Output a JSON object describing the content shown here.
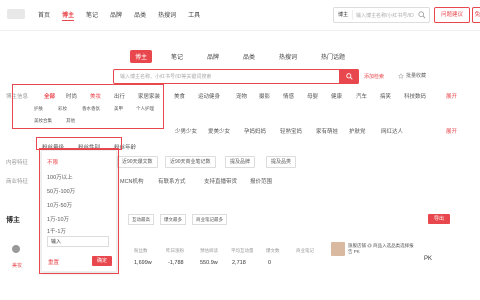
{
  "topnav": {
    "items": [
      "首页",
      "博主",
      "笔记",
      "品牌",
      "品类",
      "热搜词",
      "工具"
    ],
    "active_index": 1,
    "search_select": "博主",
    "search_placeholder": "输入博主名称/小红书号/ID",
    "feedback_label": "问题建议",
    "trial_label": "免费试用"
  },
  "subtabs": {
    "items": [
      "博主",
      "笔记",
      "品牌",
      "品类",
      "热搜词",
      "热门话题"
    ],
    "active_index": 0
  },
  "search": {
    "placeholder": "输入博主名称、小红书号/ID等关键词搜索",
    "advanced_label": "添加检索",
    "favorite_label": "批量收藏"
  },
  "filters": {
    "category_label": "博主信息",
    "categories_row1": [
      "全部",
      "时尚",
      "美妆",
      "出行",
      "家居家装",
      "美食",
      "运动健身",
      "宠物",
      "摄影",
      "情感",
      "母婴",
      "健康",
      "汽车",
      "搞笑",
      "科技数码"
    ],
    "expand_label": "展开",
    "categories_row2": [
      "护肤",
      "彩妆",
      "香水香氛",
      "美甲",
      "个人护理"
    ],
    "categories_row3": [
      "美妆合集",
      "其他"
    ],
    "tags_label": "",
    "tags": [
      "少男少女",
      "爱美少女",
      "孕妈妈妈",
      "轻熟宝妈",
      "家有萌娃",
      "护肤党",
      "网红达人"
    ],
    "tags_expand": "展开",
    "dropdowns": [
      "粉丝量级",
      "粉丝性别",
      "粉丝年龄"
    ],
    "content_label": "内容特征",
    "content_chips": [
      "近90天爆文数",
      "近90天商业笔记数",
      "提及品牌",
      "提及品类"
    ],
    "platform_label": "商业特征",
    "platform_chips": [
      "MCN机构",
      "有联系方式",
      "支持直播带货",
      "报价范围"
    ]
  },
  "dropdown": {
    "options": [
      "不限",
      "100万以上",
      "50万-100万",
      "10万-50万",
      "1万-10万",
      "1千-1万"
    ],
    "selected_index": 0,
    "custom_label": "输入",
    "reset_label": "重置",
    "ok_label": "确定"
  },
  "table": {
    "title": "博主",
    "sort_buttons": [
      "互动最高",
      "爆文最多",
      "商业笔记最多"
    ],
    "export_label": "导出",
    "col_headers": [
      "粉丝数",
      "昨日涨粉",
      "预估阅读",
      "平均互动量",
      "爆文数",
      "商业笔记"
    ],
    "col_values": [
      "1,699w",
      "-1,788",
      "550.9w",
      "2,718",
      "0",
      ""
    ],
    "product_text": "旗舰店铺 @ 商品入选品类选择报告 PK",
    "pk_label": "PK",
    "row_name": "博主",
    "row_tag": "美妆"
  }
}
